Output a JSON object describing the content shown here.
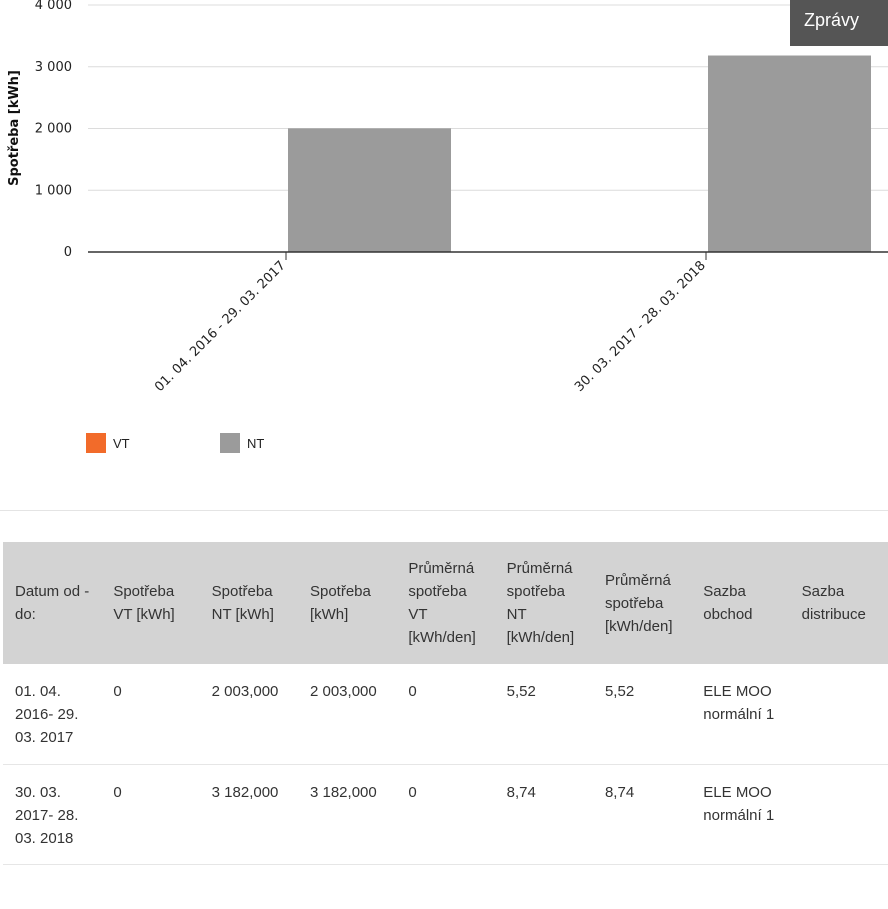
{
  "header": {
    "messages_button": "Zprávy"
  },
  "chart_data": {
    "type": "bar",
    "ylabel": "Spotřeba [kWh]",
    "ylim": [
      0,
      4000
    ],
    "yticks": [
      0,
      1000,
      2000,
      3000,
      4000
    ],
    "ytick_labels": [
      "0",
      "1 000",
      "2 000",
      "3 000",
      "4 000"
    ],
    "categories": [
      "01. 04. 2016 - 29. 03. 2017",
      "30. 03. 2017 - 28. 03. 2018"
    ],
    "series": [
      {
        "name": "VT",
        "color": "#f26b2a",
        "values": [
          0,
          0
        ]
      },
      {
        "name": "NT",
        "color": "#9b9b9b",
        "values": [
          2003,
          3182
        ]
      }
    ],
    "legend": "bottom-left"
  },
  "table": {
    "headers": [
      "Datum od - do:",
      "Spotřeba VT [kWh]",
      "Spotřeba NT [kWh]",
      "Spotřeba [kWh]",
      "Průměrná spotřeba VT [kWh/den]",
      "Průměrná spotřeba NT [kWh/den]",
      "Průměrná spotřeba [kWh/den]",
      "Sazba obchod",
      "Sazba distribuce"
    ],
    "rows": [
      [
        "01. 04. 2016- 29. 03. 2017",
        "0",
        "2 003,000",
        "2 003,000",
        "0",
        "5,52",
        "5,52",
        "ELE MOO normální 1",
        ""
      ],
      [
        "30. 03. 2017- 28. 03. 2018",
        "0",
        "3 182,000",
        "3 182,000",
        "0",
        "8,74",
        "8,74",
        "ELE MOO normální 1",
        ""
      ]
    ]
  }
}
